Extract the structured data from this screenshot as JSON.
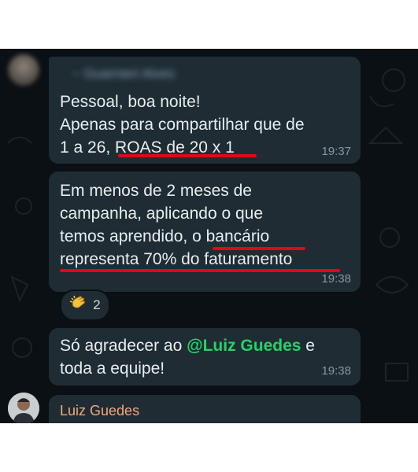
{
  "messages": [
    {
      "sender": "~ Guarnieri Alves",
      "text": "Pessoal, boa noite!\nApenas para compartilhar que de\n1 a 26, ROAS de 20 x 1",
      "time": "19:37"
    },
    {
      "text": "Em menos de 2 meses de\ncampanha, aplicando o que\ntemos aprendido, o bancário\nrepresenta 70% do faturamento",
      "time": "19:38",
      "reaction": {
        "emoji_icon": "clapping-hands-icon",
        "count": "2"
      }
    },
    {
      "text_before": "Só agradecer ao ",
      "mention": "@Luiz Guedes",
      "text_after": "  e\ntoda a equipe!",
      "time": "19:38"
    },
    {
      "sender": "Luiz Guedes"
    }
  ],
  "colors": {
    "background": "#0b1014",
    "bubble": "#1f2c33",
    "text": "#e9edef",
    "time": "#8696a0",
    "mention": "#25d366",
    "sender_name": "#f2a97e",
    "highlight_underline": "#e2061b"
  }
}
